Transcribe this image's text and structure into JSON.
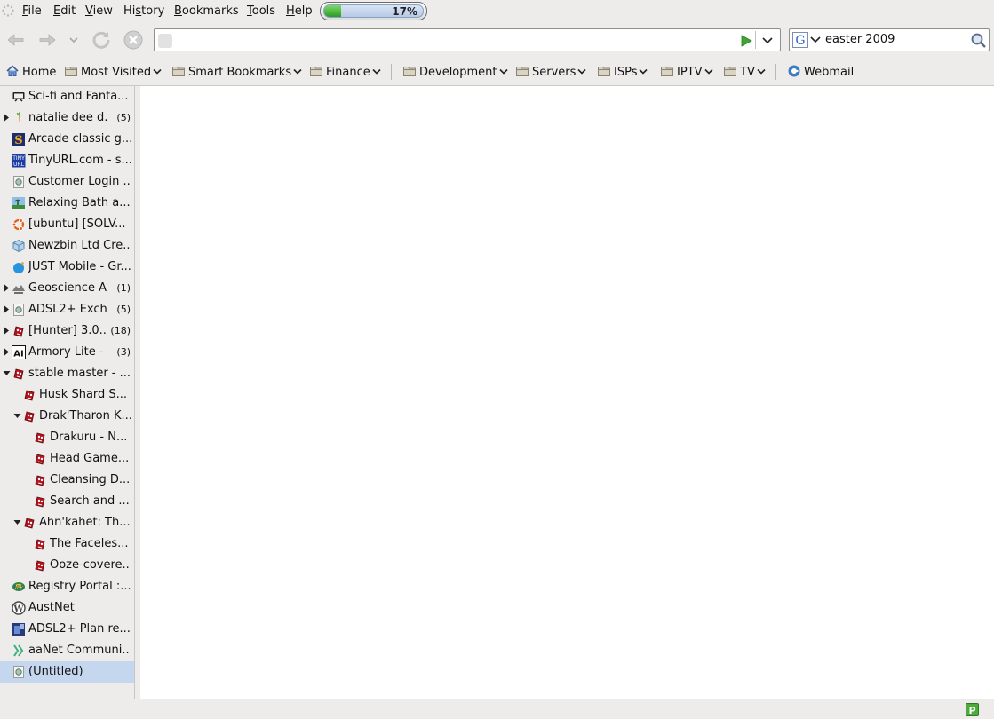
{
  "menubar": {
    "items": [
      "File",
      "Edit",
      "View",
      "History",
      "Bookmarks",
      "Tools",
      "Help"
    ],
    "accelerators": [
      "F",
      "E",
      "V",
      "s",
      "B",
      "T",
      "H"
    ],
    "memory_meter": {
      "label": "17%",
      "fraction": 0.17
    }
  },
  "navbar": {
    "url_value": "",
    "search_engine": "google-icon",
    "search_value": "easter 2009"
  },
  "bookmarks_toolbar": [
    {
      "label": "Home",
      "icon": "home-icon",
      "menu": false
    },
    {
      "label": "Most Visited",
      "icon": "folder-icon",
      "menu": true
    },
    {
      "label": "Smart Bookmarks",
      "icon": "folder-icon",
      "menu": true
    },
    {
      "label": "Finance",
      "icon": "folder-icon",
      "menu": true
    },
    {
      "label": "Development",
      "icon": "folder-icon",
      "menu": true
    },
    {
      "label": "Servers",
      "icon": "folder-icon",
      "menu": true
    },
    {
      "label": "ISPs",
      "icon": "folder-icon",
      "menu": true
    },
    {
      "label": "IPTV",
      "icon": "folder-icon",
      "menu": true
    },
    {
      "label": "TV",
      "icon": "folder-icon",
      "menu": true
    },
    {
      "label": "Webmail",
      "icon": "webmail-icon",
      "menu": false
    }
  ],
  "sidebar": {
    "rows": [
      {
        "label": "Sci-fi and Fanta...",
        "count": "",
        "level": 0,
        "twisty": "none",
        "icon": "tv-icon"
      },
      {
        "label": "natalie dee d...",
        "count": "(5)",
        "level": 0,
        "twisty": "closed",
        "icon": "carrot-icon"
      },
      {
        "label": "Arcade classic g...",
        "count": "",
        "level": 0,
        "twisty": "none",
        "icon": "s-logo-icon"
      },
      {
        "label": "TinyURL.com - s...",
        "count": "",
        "level": 0,
        "twisty": "none",
        "icon": "tinyurl-icon"
      },
      {
        "label": "Customer Login ...",
        "count": "",
        "level": 0,
        "twisty": "none",
        "icon": "page-icon"
      },
      {
        "label": "Relaxing Bath a...",
        "count": "",
        "level": 0,
        "twisty": "none",
        "icon": "landscape-icon"
      },
      {
        "label": "[ubuntu] [SOLV...",
        "count": "",
        "level": 0,
        "twisty": "none",
        "icon": "ubuntu-icon"
      },
      {
        "label": "Newzbin Ltd Cre...",
        "count": "",
        "level": 0,
        "twisty": "none",
        "icon": "cube-icon"
      },
      {
        "label": "JUST Mobile - Gr...",
        "count": "",
        "level": 0,
        "twisty": "none",
        "icon": "globe-icon"
      },
      {
        "label": "Geoscience A...",
        "count": "(1)",
        "level": 0,
        "twisty": "closed",
        "icon": "geoscience-icon"
      },
      {
        "label": "ADSL2+ Exch...",
        "count": "(5)",
        "level": 0,
        "twisty": "closed",
        "icon": "page-icon"
      },
      {
        "label": "[Hunter] 3.0...",
        "count": "(18)",
        "level": 0,
        "twisty": "closed",
        "icon": "wowhead-icon"
      },
      {
        "label": "Armory Lite - ...",
        "count": "(3)",
        "level": 0,
        "twisty": "closed",
        "icon": "ai-icon"
      },
      {
        "label": "stable master - ...",
        "count": "",
        "level": 0,
        "twisty": "open",
        "icon": "wowhead-icon"
      },
      {
        "label": "Husk Shard S...",
        "count": "",
        "level": 1,
        "twisty": "none",
        "icon": "wowhead-icon"
      },
      {
        "label": "Drak'Tharon K...",
        "count": "",
        "level": 1,
        "twisty": "open",
        "icon": "wowhead-icon"
      },
      {
        "label": "Drakuru - N...",
        "count": "",
        "level": 2,
        "twisty": "none",
        "icon": "wowhead-icon"
      },
      {
        "label": "Head Game...",
        "count": "",
        "level": 2,
        "twisty": "none",
        "icon": "wowhead-icon"
      },
      {
        "label": "Cleansing D...",
        "count": "",
        "level": 2,
        "twisty": "none",
        "icon": "wowhead-icon"
      },
      {
        "label": "Search and ...",
        "count": "",
        "level": 2,
        "twisty": "none",
        "icon": "wowhead-icon"
      },
      {
        "label": "Ahn'kahet: Th...",
        "count": "",
        "level": 1,
        "twisty": "open",
        "icon": "wowhead-icon"
      },
      {
        "label": "The Faceles...",
        "count": "",
        "level": 2,
        "twisty": "none",
        "icon": "wowhead-icon"
      },
      {
        "label": "Ooze-covere...",
        "count": "",
        "level": 2,
        "twisty": "none",
        "icon": "wowhead-icon"
      },
      {
        "label": "Registry Portal :...",
        "count": "",
        "level": 0,
        "twisty": "none",
        "icon": "au-icon"
      },
      {
        "label": "AustNet",
        "count": "",
        "level": 0,
        "twisty": "none",
        "icon": "wordpress-icon"
      },
      {
        "label": "ADSL2+ Plan re...",
        "count": "",
        "level": 0,
        "twisty": "none",
        "icon": "photo-icon"
      },
      {
        "label": "aaNet Communi...",
        "count": "",
        "level": 0,
        "twisty": "none",
        "icon": "chevrons-icon"
      },
      {
        "label": "(Untitled)",
        "count": "",
        "level": 0,
        "twisty": "none",
        "icon": "page-icon",
        "selected": true
      }
    ]
  },
  "statusbar": {
    "badge": "P"
  }
}
